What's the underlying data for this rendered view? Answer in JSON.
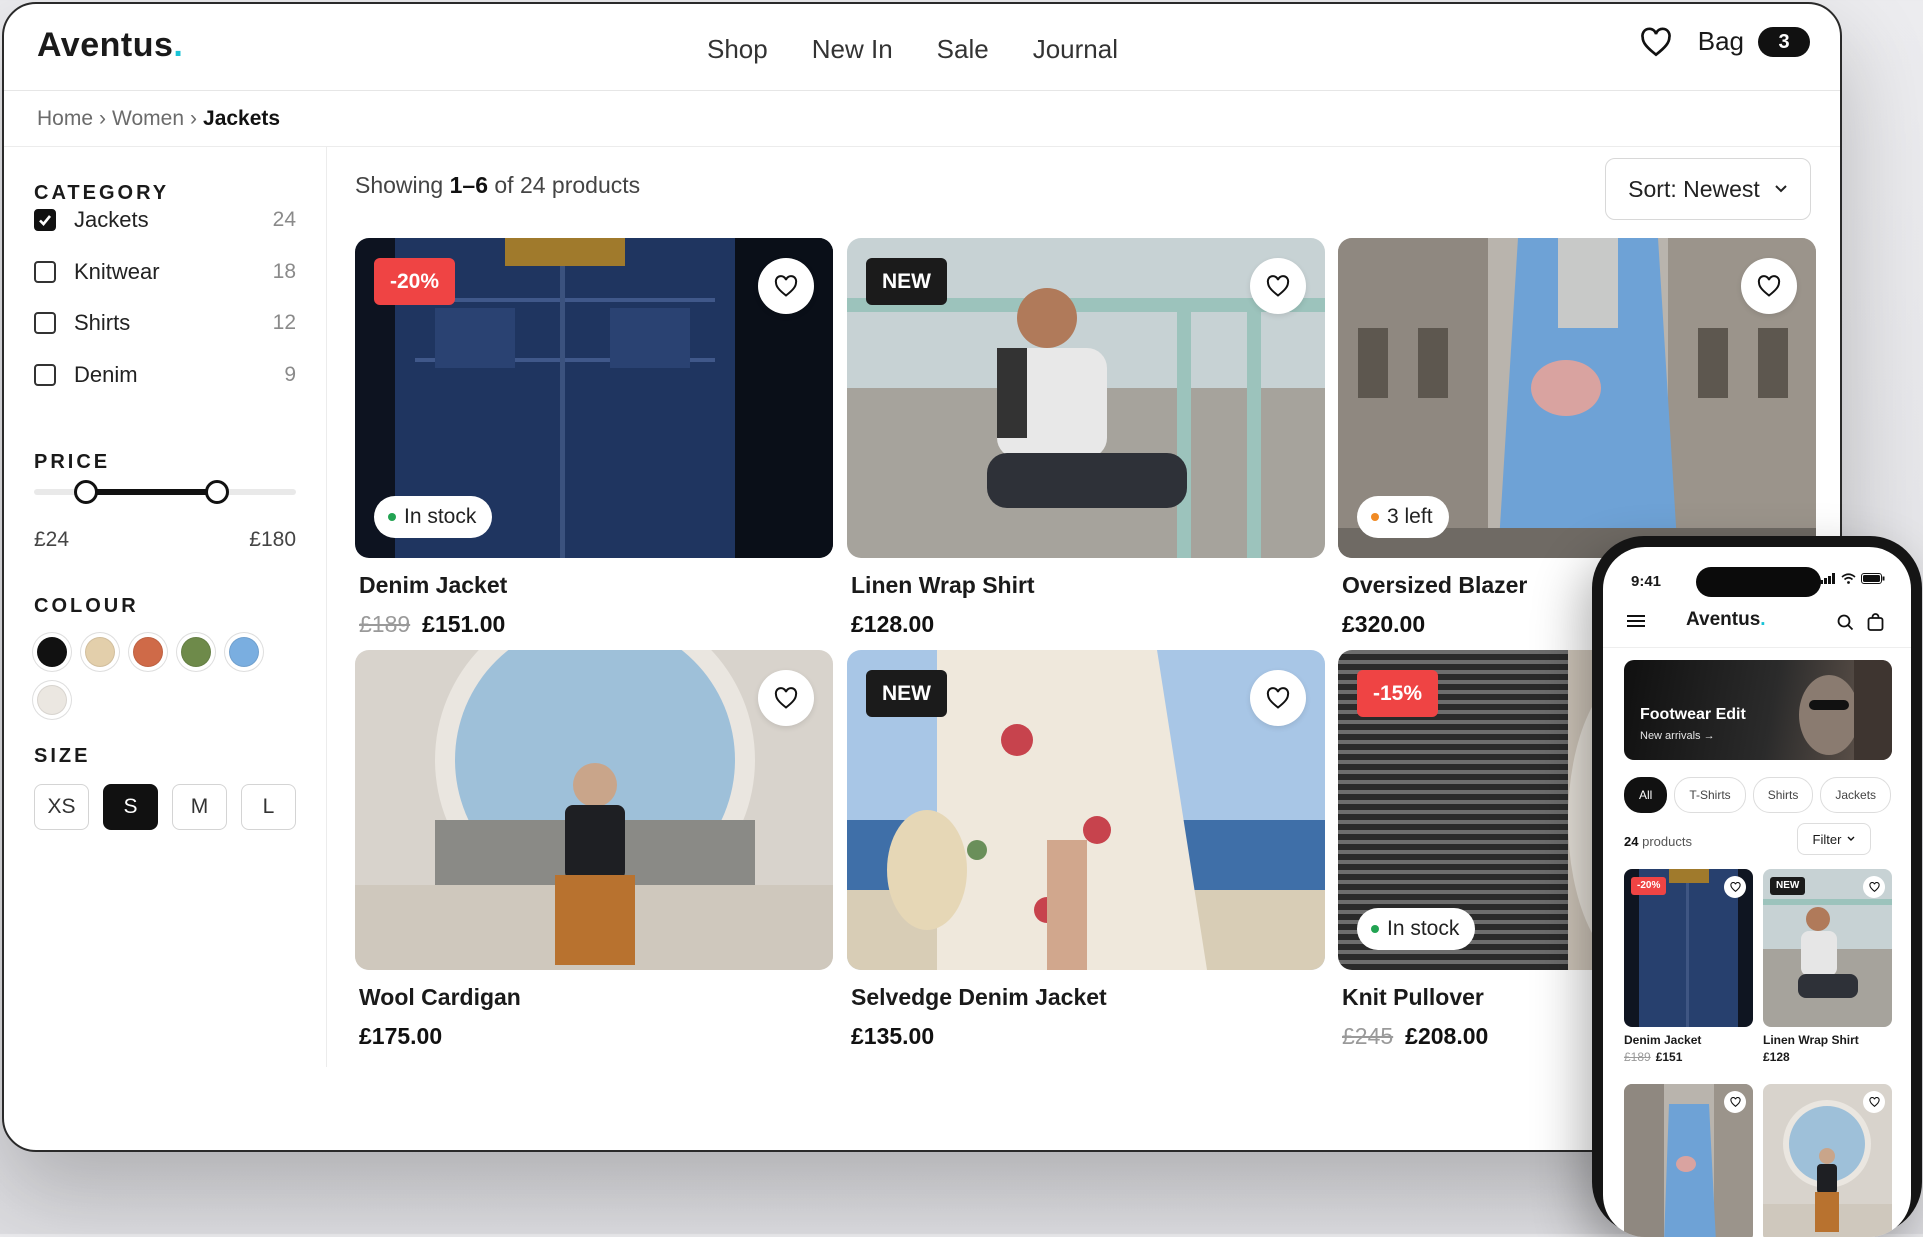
{
  "brand": {
    "name": "Aventus",
    "dot": "."
  },
  "nav": [
    "Shop",
    "New In",
    "Sale",
    "Journal"
  ],
  "header": {
    "bag_label": "Bag",
    "bag_count": "3"
  },
  "breadcrumb": {
    "items": [
      "Home",
      "Women"
    ],
    "sep": "›",
    "current": "Jackets"
  },
  "filters": {
    "category_title": "CATEGORY",
    "categories": [
      {
        "label": "Jackets",
        "count": "24",
        "checked": true
      },
      {
        "label": "Knitwear",
        "count": "18",
        "checked": false
      },
      {
        "label": "Shirts",
        "count": "12",
        "checked": false
      },
      {
        "label": "Denim",
        "count": "9",
        "checked": false
      }
    ],
    "price_title": "PRICE",
    "price_min": "£24",
    "price_max": "£180",
    "price_range_fraction": [
      0.2,
      0.7
    ],
    "colour_title": "COLOUR",
    "colours": [
      "#111111",
      "#e3cfab",
      "#cf6a48",
      "#6e8a4a",
      "#7aaee0",
      "#ebe7e1"
    ],
    "size_title": "SIZE",
    "sizes": [
      "XS",
      "S",
      "M",
      "L"
    ],
    "size_selected": "S"
  },
  "listing": {
    "showing_prefix": "Showing",
    "showing_range": "1–6",
    "showing_suffix": "of 24 products",
    "sort_label": "Sort: Newest"
  },
  "products": [
    {
      "name": "Denim Jacket",
      "old_price": "£189",
      "price": "£151.00",
      "badge": "-20%",
      "stock": "In stock"
    },
    {
      "name": "Linen Wrap Shirt",
      "old_price": "",
      "price": "£128.00",
      "badge": "NEW",
      "stock": ""
    },
    {
      "name": "Oversized Blazer",
      "old_price": "",
      "price": "£320.00",
      "badge": "",
      "stock": "3 left"
    },
    {
      "name": "Wool Cardigan",
      "old_price": "",
      "price": "£175.00",
      "badge": "",
      "stock": ""
    },
    {
      "name": "Selvedge Denim Jacket",
      "old_price": "",
      "price": "£135.00",
      "badge": "NEW",
      "stock": ""
    },
    {
      "name": "Knit Pullover",
      "old_price": "£245",
      "price": "£208.00",
      "badge": "-15%",
      "stock": "In stock"
    }
  ],
  "colors": {
    "sale": "#ef4444",
    "accent": "#19c3d6",
    "in_stock": "#22a352",
    "low_stock": "#f08a24"
  },
  "mobile": {
    "time": "9:41",
    "logo": "Aventus",
    "banner_title": "Footwear Edit",
    "banner_sub": "New arrivals →",
    "chips": [
      "All",
      "T-Shirts",
      "Shirts",
      "Jackets"
    ],
    "count_number": "24",
    "count_label": "products",
    "filter_label": "Filter",
    "products": [
      {
        "name": "Denim Jacket",
        "old_price": "£189",
        "price": "£151",
        "badge": "-20%"
      },
      {
        "name": "Linen Wrap Shirt",
        "old_price": "",
        "price": "£128",
        "badge": "NEW"
      }
    ]
  }
}
